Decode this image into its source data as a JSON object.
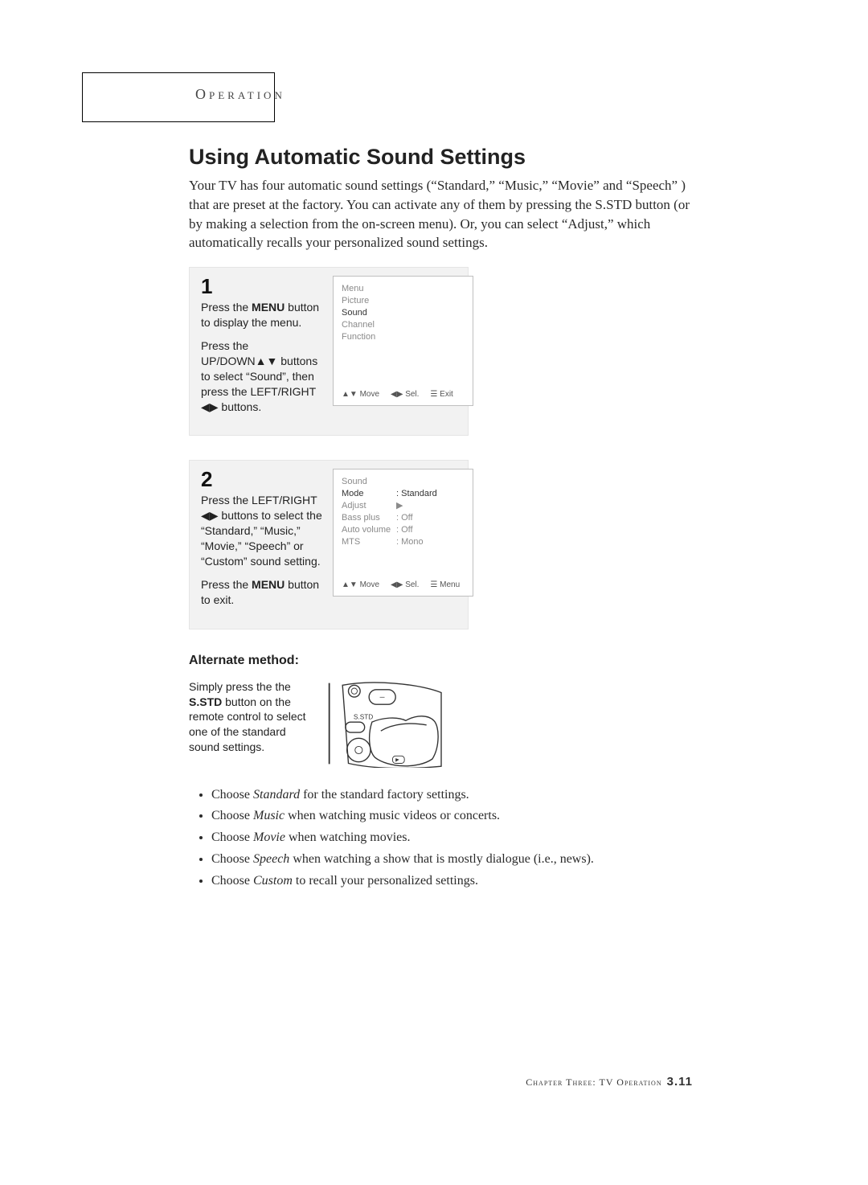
{
  "header": {
    "op_label": "Operation"
  },
  "title": "Using Automatic Sound Settings",
  "intro": "Your TV has four automatic sound settings (“Standard,” “Music,” “Movie” and “Speech” ) that are preset at the factory.  You can activate any of them by pressing the S.STD button (or by making a selection from the on-screen menu). Or, you can select “Adjust,” which automatically recalls your personalized sound settings.",
  "step1": {
    "num": "1",
    "p1a": "Press the ",
    "p1b": "MENU",
    "p1c": " button to display the menu.",
    "p2": "Press the UP/DOWN▲▼ buttons to select “Sound”, then press the LEFT/RIGHT ◀▶ buttons.",
    "osd": {
      "title": "Menu",
      "items": [
        "Picture",
        "Sound",
        "Channel",
        "Function"
      ],
      "selected": "Sound",
      "foot_move": "▲▼ Move",
      "foot_sel": "◀▶ Sel.",
      "foot_exit": "☰ Exit"
    }
  },
  "step2": {
    "num": "2",
    "p1": "Press the LEFT/RIGHT ◀▶ buttons to select the “Standard,” “Music,” “Movie,” “Speech” or “Custom” sound setting.",
    "p2a": "Press the ",
    "p2b": "MENU",
    "p2c": " button to exit.",
    "osd": {
      "title": "Sound",
      "rows": [
        {
          "k": "Mode",
          "v": ": Standard",
          "sel": true
        },
        {
          "k": "Adjust",
          "v": "▶"
        },
        {
          "k": "Bass plus",
          "v": ": Off"
        },
        {
          "k": "Auto volume",
          "v": ": Off"
        },
        {
          "k": "MTS",
          "v": ": Mono"
        }
      ],
      "foot_move": "▲▼ Move",
      "foot_sel": "◀▶ Sel.",
      "foot_menu": "☰ Menu"
    }
  },
  "alt": {
    "heading": "Alternate method:",
    "t1": "Simply press the the ",
    "t2": "S.STD",
    "t3": " button on the remote control to select one of the standard sound settings.",
    "remote_label": "S.STD"
  },
  "modes": [
    {
      "pre": "Choose ",
      "em": "Standard",
      "post": " for the standard factory settings."
    },
    {
      "pre": "Choose ",
      "em": "Music",
      "post": " when watching music videos or concerts."
    },
    {
      "pre": "Choose ",
      "em": "Movie",
      "post": " when watching movies."
    },
    {
      "pre": "Choose ",
      "em": "Speech",
      "post": " when watching a show that is mostly dialogue (i.e., news)."
    },
    {
      "pre": "Choose ",
      "em": "Custom",
      "post": " to recall your personalized settings."
    }
  ],
  "footer": {
    "chapter_label": "Chapter Three: TV Operation",
    "page_num": "3.11"
  }
}
